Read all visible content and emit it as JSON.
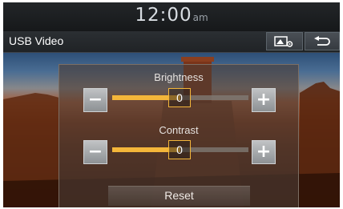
{
  "clock": {
    "time": "12:00",
    "ampm": "am"
  },
  "header": {
    "title": "USB Video"
  },
  "settings": {
    "brightness": {
      "label": "Brightness",
      "value": "0",
      "level": 0.5
    },
    "contrast": {
      "label": "Contrast",
      "value": "0",
      "level": 0.5
    },
    "reset_label": "Reset"
  },
  "colors": {
    "accent": "#f4b63a",
    "panel": "#4e3e36"
  },
  "icons": {
    "picture_settings": "picture-settings-icon",
    "back": "back-arrow-icon",
    "minus": "minus-icon",
    "plus": "plus-icon"
  }
}
